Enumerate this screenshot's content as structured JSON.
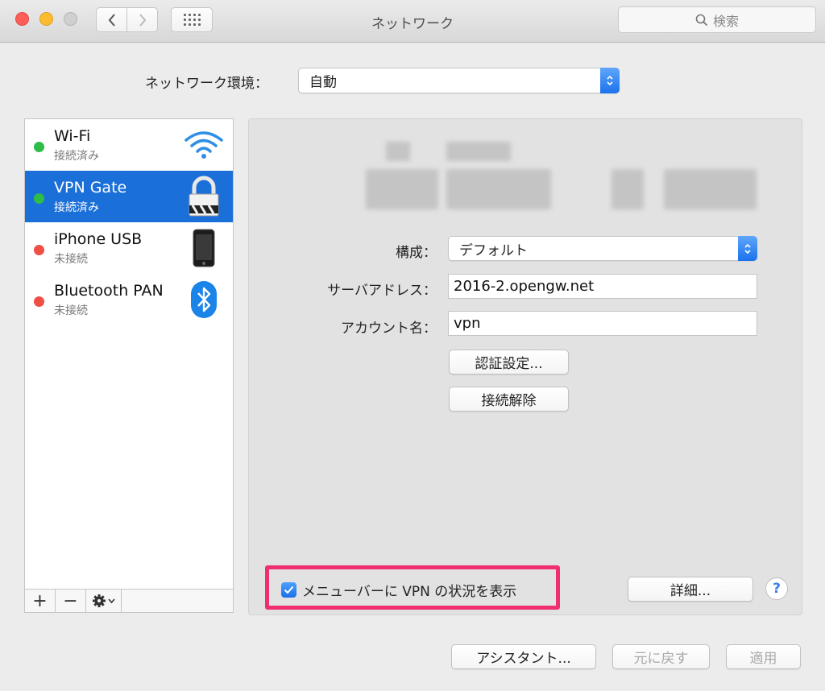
{
  "window": {
    "title": "ネットワーク"
  },
  "search": {
    "placeholder": "検索"
  },
  "location": {
    "label": "ネットワーク環境：",
    "value": "自動"
  },
  "services": [
    {
      "name": "Wi-Fi",
      "status": "接続済み",
      "status_color": "#2ebe47",
      "icon": "wifi-icon"
    },
    {
      "name": "VPN Gate",
      "status": "接続済み",
      "status_color": "#2ebe47",
      "icon": "lock-icon",
      "selected": true
    },
    {
      "name": "iPhone USB",
      "status": "未接続",
      "status_color": "#ef4f45",
      "icon": "iphone-icon"
    },
    {
      "name": "Bluetooth PAN",
      "status": "未接続",
      "status_color": "#ef4f45",
      "icon": "bluetooth-icon"
    }
  ],
  "sidebar_toolbar": {
    "add": "+",
    "remove": "−"
  },
  "vpn": {
    "config_label": "構成：",
    "config_value": "デフォルト",
    "server_label": "サーバアドレス：",
    "server_value": "2016-2.opengw.net",
    "account_label": "アカウント名：",
    "account_value": "vpn",
    "auth_button": "認証設定...",
    "disconnect_button": "接続解除",
    "show_status_label": "メニューバーに VPN の状況を表示",
    "show_status_checked": true,
    "advanced_button": "詳細...",
    "help_button": "?"
  },
  "footer": {
    "assistant": "アシスタント...",
    "revert": "元に戻す",
    "apply": "適用"
  },
  "colors": {
    "accent": "#1a6fd8",
    "highlight": "#f0306e"
  }
}
